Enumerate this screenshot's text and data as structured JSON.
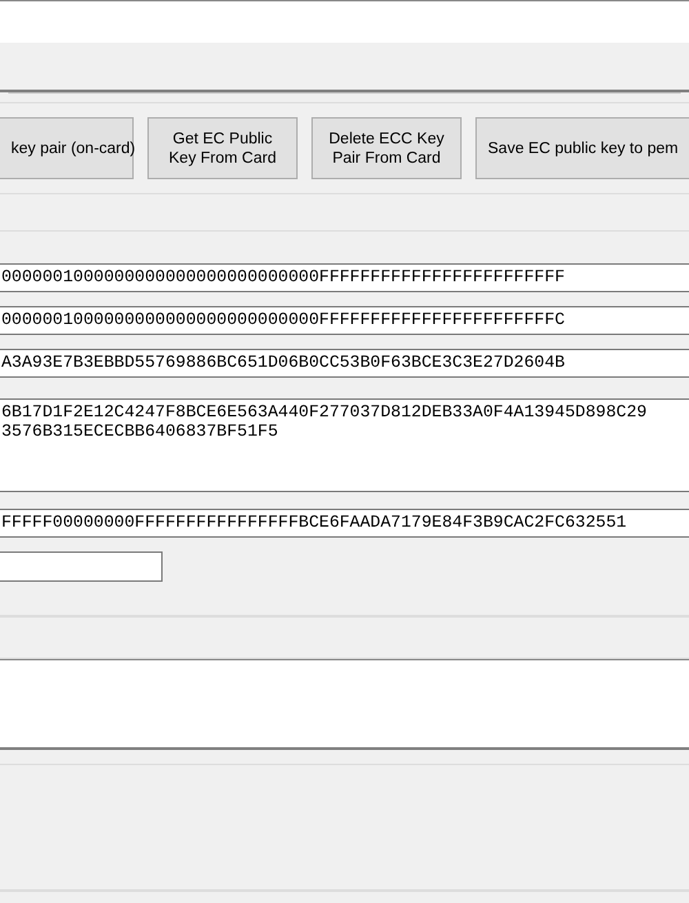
{
  "buttons": [
    {
      "label": "key pair (on-card)",
      "cut_left": true
    },
    {
      "label": "Get EC Public Key From Card",
      "cut_left": false
    },
    {
      "label": "Delete ECC Key Pair From Card",
      "cut_left": false
    },
    {
      "label": "Save EC public key to pem",
      "cut_left": false
    }
  ],
  "fields": [
    {
      "kind": "line",
      "lines": [
        "0000001000000000000000000000000FFFFFFFFFFFFFFFFFFFFFFFF"
      ]
    },
    {
      "kind": "line",
      "lines": [
        "0000001000000000000000000000000FFFFFFFFFFFFFFFFFFFFFFFC"
      ]
    },
    {
      "kind": "line",
      "lines": [
        "A3A93E7B3EBBD55769886BC651D06B0CC53B0F63BCE3C3E27D2604B"
      ]
    },
    {
      "kind": "multi",
      "lines": [
        "6B17D1F2E12C4247F8BCE6E563A440F277037D812DEB33A0F4A13945D898C29",
        "3576B315ECECBB6406837BF51F5"
      ]
    },
    {
      "kind": "line",
      "lines": [
        "FFFFF00000000FFFFFFFFFFFFFFFFBCE6FAADA7179E84F3B9CAC2FC632551"
      ]
    },
    {
      "kind": "short"
    }
  ]
}
